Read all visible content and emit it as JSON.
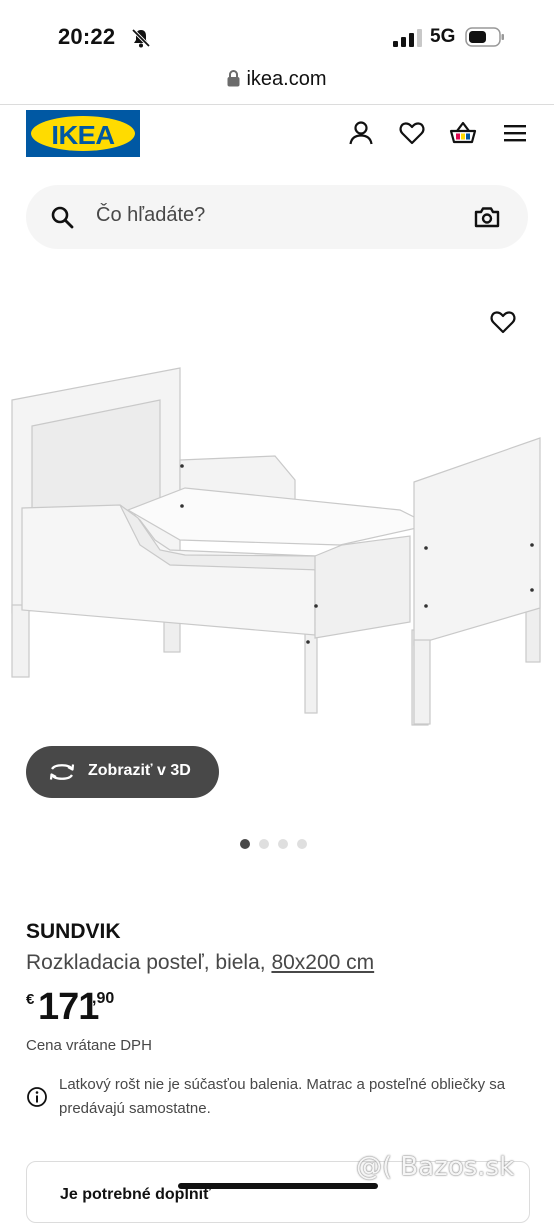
{
  "status_bar": {
    "time": "20:22",
    "network": "5G"
  },
  "browser": {
    "url": "ikea.com"
  },
  "header": {
    "logo_text": "IKEA",
    "icons": [
      "user-icon",
      "heart-icon",
      "cart-icon",
      "menu-icon"
    ]
  },
  "search": {
    "placeholder": "Čo hľadáte?"
  },
  "gallery": {
    "view_3d_label": "Zobraziť v 3D",
    "slide_count": 4,
    "active_slide": 1
  },
  "product": {
    "name": "SUNDVIK",
    "description": "Rozkladacia posteľ, biela,",
    "size": "80x200 cm",
    "currency": "€",
    "price_main": "171",
    "price_decimal": ",90",
    "vat_note": "Cena vrátane DPH",
    "info_note": "Latkový rošt nie je súčasťou balenia. Matrac a posteľné obliečky sa predávajú samostatne."
  },
  "card": {
    "title": "Je potrebné doplniť"
  },
  "watermark": "@( Bazos.sk",
  "colors": {
    "ikea_blue": "#0058a3",
    "ikea_yellow": "#ffdb00",
    "button_dark": "#484848"
  }
}
